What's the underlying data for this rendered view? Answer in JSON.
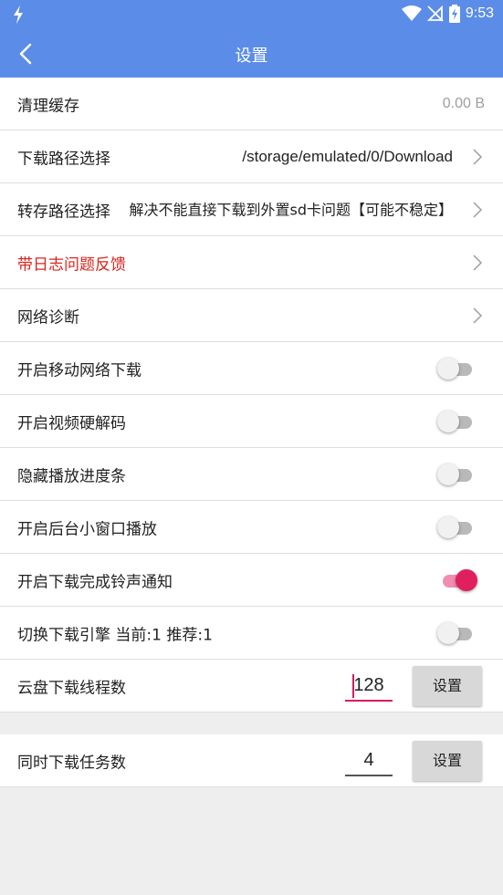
{
  "status": {
    "time": "9:53",
    "accent": "#5b8de8"
  },
  "toolbar": {
    "title": "设置"
  },
  "rows": {
    "clear_cache": {
      "label": "清理缓存",
      "value": "0.00 B"
    },
    "download_path": {
      "label": "下载路径选择",
      "value": "/storage/emulated/0/Download"
    },
    "transfer_path": {
      "label": "转存路径选择",
      "value": "解决不能直接下载到外置sd卡问题【可能不稳定】"
    },
    "feedback": {
      "label": "带日志问题反馈"
    },
    "network_diag": {
      "label": "网络诊断"
    },
    "mobile_download": {
      "label": "开启移动网络下载",
      "on": false
    },
    "hw_decode": {
      "label": "开启视频硬解码",
      "on": false
    },
    "hide_progress": {
      "label": "隐藏播放进度条",
      "on": false
    },
    "bg_window": {
      "label": "开启后台小窗口播放",
      "on": false
    },
    "ringtone": {
      "label": "开启下载完成铃声通知",
      "on": true
    },
    "engine": {
      "label": "切换下载引擎  当前:1    推荐:1",
      "on": false
    },
    "cloud_threads": {
      "label": "云盘下载线程数",
      "value": "128",
      "button": "设置"
    },
    "concurrent_tasks": {
      "label": "同时下载任务数",
      "value": "4",
      "button": "设置"
    }
  }
}
